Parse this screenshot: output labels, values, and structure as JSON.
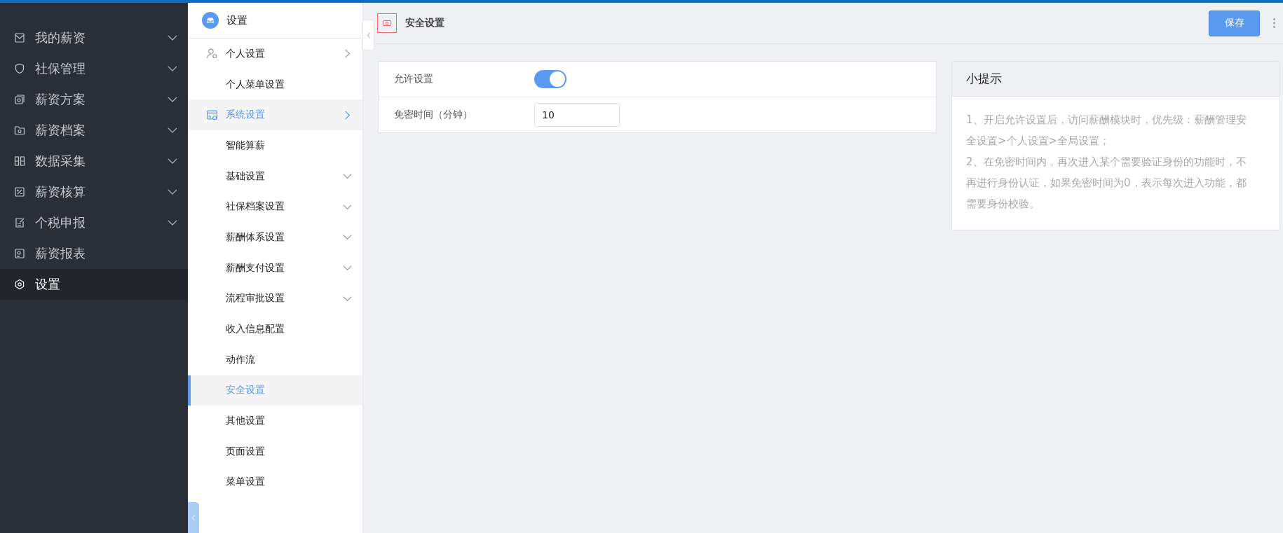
{
  "main_nav": [
    {
      "label": "我的薪资",
      "expandable": true,
      "selected": false
    },
    {
      "label": "社保管理",
      "expandable": true,
      "selected": false
    },
    {
      "label": "薪资方案",
      "expandable": true,
      "selected": false
    },
    {
      "label": "薪资档案",
      "expandable": true,
      "selected": false
    },
    {
      "label": "数据采集",
      "expandable": true,
      "selected": false
    },
    {
      "label": "薪资核算",
      "expandable": true,
      "selected": false
    },
    {
      "label": "个税申报",
      "expandable": true,
      "selected": false
    },
    {
      "label": "薪资报表",
      "expandable": false,
      "selected": false
    },
    {
      "label": "设置",
      "expandable": false,
      "selected": true
    }
  ],
  "sub_nav": {
    "title": "设置",
    "items": [
      {
        "label": "个人设置",
        "kind": "group",
        "selected": false
      },
      {
        "label": "个人菜单设置",
        "kind": "item",
        "selected": false
      },
      {
        "label": "系统设置",
        "kind": "group",
        "selected": false,
        "active": true
      },
      {
        "label": "智能算薪",
        "kind": "item",
        "selected": false
      },
      {
        "label": "基础设置",
        "kind": "folder",
        "selected": false
      },
      {
        "label": "社保档案设置",
        "kind": "folder",
        "selected": false
      },
      {
        "label": "薪酬体系设置",
        "kind": "folder",
        "selected": false
      },
      {
        "label": "薪酬支付设置",
        "kind": "folder",
        "selected": false
      },
      {
        "label": "流程审批设置",
        "kind": "folder",
        "selected": false
      },
      {
        "label": "收入信息配置",
        "kind": "item",
        "selected": false
      },
      {
        "label": "动作流",
        "kind": "item",
        "selected": false
      },
      {
        "label": "安全设置",
        "kind": "item",
        "selected": true
      },
      {
        "label": "其他设置",
        "kind": "item",
        "selected": false
      },
      {
        "label": "页面设置",
        "kind": "item",
        "selected": false
      },
      {
        "label": "菜单设置",
        "kind": "item",
        "selected": false
      }
    ]
  },
  "page": {
    "title": "安全设置",
    "save_button": "保存"
  },
  "form": [
    {
      "kind": "switch",
      "label": "允许设置",
      "on": true
    },
    {
      "kind": "input",
      "label": "免密时间（分钟）",
      "value": "10"
    }
  ],
  "tips": {
    "title": "小提示",
    "lines": [
      "1、开启允许设置后，访问薪酬模块时，优先级：薪酬管理安全设置>个人设置>全局设置；",
      "2、在免密时间内，再次进入某个需要验证身份的功能时，不再进行身份认证，如果免密时间为0，表示每次进入功能，都需要身份校验。"
    ]
  }
}
